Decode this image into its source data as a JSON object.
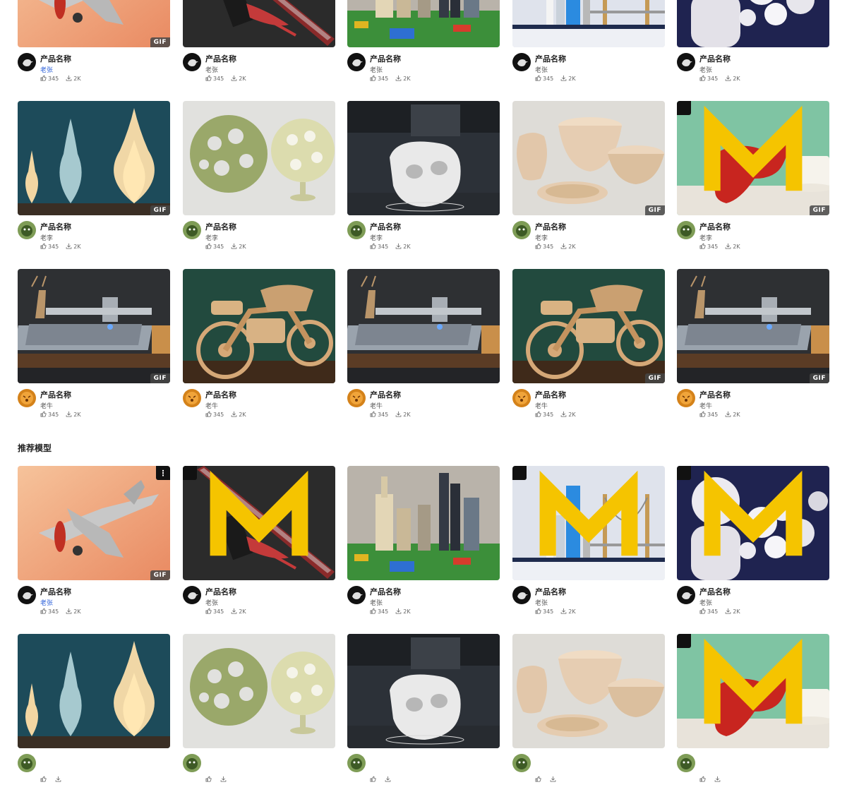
{
  "section": {
    "title": "推荐模型"
  },
  "icons": {
    "like": "thumbs-up-icon",
    "download": "download-icon",
    "brand": "brand-logo-icon",
    "more": "more-vertical-icon"
  },
  "thumbnails": {
    "airplane": {
      "name": "airplane-model",
      "bg": "#f0b68c",
      "accent": "#c8c8c8"
    },
    "sword": {
      "name": "sword-model",
      "bg": "#2b2b2b",
      "accent": "#c43a3a"
    },
    "city": {
      "name": "city-lego-model",
      "bg": "#b9b3aa",
      "accent": "#3c8f3a"
    },
    "skyline": {
      "name": "skyline-lego-model",
      "bg": "#dfe3ec",
      "accent": "#2b8be0"
    },
    "balloon": {
      "name": "balloon-figure-model",
      "bg": "#1f2350",
      "accent": "#eceaf0"
    },
    "lamps": {
      "name": "vase-lamp-model",
      "bg": "#1d4b5a",
      "accent": "#f2d6a2"
    },
    "spheres": {
      "name": "lattice-sphere-model",
      "bg": "#e1e1de",
      "accent": "#9aa86a"
    },
    "skull": {
      "name": "skull-lattice-model",
      "bg": "#2c3138",
      "accent": "#e9e9e9"
    },
    "bowls": {
      "name": "spiral-bowl-model",
      "bg": "#dedcd7",
      "accent": "#e6cdb2"
    },
    "rhino": {
      "name": "lattice-animal-model",
      "bg": "#7fc4a3",
      "accent": "#c8251f"
    },
    "laser": {
      "name": "laser-engraver-model",
      "bg": "#2e3033",
      "accent": "#9aa3ad"
    },
    "motorcycle": {
      "name": "wooden-motorcycle-model",
      "bg": "#224a3e",
      "accent": "#d5a877"
    }
  },
  "avatars": {
    "bird": {
      "bg": "#111111",
      "fg": "#e0e0e0"
    },
    "dino": {
      "bg": "#7e9c56",
      "fg": "#3d5a25"
    },
    "tiger": {
      "bg": "#d4821a",
      "fg": "#6b3306"
    }
  },
  "cards": [
    {
      "thumb": "airplane",
      "avatar": "bird",
      "title": "产品名称",
      "author": "老张",
      "author_active": true,
      "likes": "345",
      "downloads": "2K",
      "gif": "GIF",
      "brand": false,
      "more": false
    },
    {
      "thumb": "sword",
      "avatar": "bird",
      "title": "产品名称",
      "author": "老张",
      "author_active": false,
      "likes": "345",
      "downloads": "2K",
      "gif": "",
      "brand": false,
      "more": false
    },
    {
      "thumb": "city",
      "avatar": "bird",
      "title": "产品名称",
      "author": "老张",
      "author_active": false,
      "likes": "345",
      "downloads": "2K",
      "gif": "",
      "brand": false,
      "more": false
    },
    {
      "thumb": "skyline",
      "avatar": "bird",
      "title": "产品名称",
      "author": "老张",
      "author_active": false,
      "likes": "345",
      "downloads": "2K",
      "gif": "",
      "brand": false,
      "more": false
    },
    {
      "thumb": "balloon",
      "avatar": "bird",
      "title": "产品名称",
      "author": "老张",
      "author_active": false,
      "likes": "345",
      "downloads": "2K",
      "gif": "",
      "brand": false,
      "more": false
    },
    {
      "thumb": "lamps",
      "avatar": "dino",
      "title": "产品名称",
      "author": "老李",
      "author_active": false,
      "likes": "345",
      "downloads": "2K",
      "gif": "GIF",
      "brand": false,
      "more": false
    },
    {
      "thumb": "spheres",
      "avatar": "dino",
      "title": "产品名称",
      "author": "老李",
      "author_active": false,
      "likes": "345",
      "downloads": "2K",
      "gif": "",
      "brand": false,
      "more": false
    },
    {
      "thumb": "skull",
      "avatar": "dino",
      "title": "产品名称",
      "author": "老李",
      "author_active": false,
      "likes": "345",
      "downloads": "2K",
      "gif": "",
      "brand": false,
      "more": false
    },
    {
      "thumb": "bowls",
      "avatar": "dino",
      "title": "产品名称",
      "author": "老李",
      "author_active": false,
      "likes": "345",
      "downloads": "2K",
      "gif": "GIF",
      "brand": false,
      "more": false
    },
    {
      "thumb": "rhino",
      "avatar": "dino",
      "title": "产品名称",
      "author": "老李",
      "author_active": false,
      "likes": "345",
      "downloads": "2K",
      "gif": "GIF",
      "brand": true,
      "more": false
    },
    {
      "thumb": "laser",
      "avatar": "tiger",
      "title": "产品名称",
      "author": "老牛",
      "author_active": false,
      "likes": "345",
      "downloads": "2K",
      "gif": "GIF",
      "brand": false,
      "more": false
    },
    {
      "thumb": "motorcycle",
      "avatar": "tiger",
      "title": "产品名称",
      "author": "老牛",
      "author_active": false,
      "likes": "345",
      "downloads": "2K",
      "gif": "",
      "brand": false,
      "more": false
    },
    {
      "thumb": "laser",
      "avatar": "tiger",
      "title": "产品名称",
      "author": "老牛",
      "author_active": false,
      "likes": "345",
      "downloads": "2K",
      "gif": "",
      "brand": false,
      "more": false
    },
    {
      "thumb": "motorcycle",
      "avatar": "tiger",
      "title": "产品名称",
      "author": "老牛",
      "author_active": false,
      "likes": "345",
      "downloads": "2K",
      "gif": "GIF",
      "brand": false,
      "more": false
    },
    {
      "thumb": "laser",
      "avatar": "tiger",
      "title": "产品名称",
      "author": "老牛",
      "author_active": false,
      "likes": "345",
      "downloads": "2K",
      "gif": "GIF",
      "brand": false,
      "more": false
    },
    {
      "thumb": "airplane",
      "avatar": "bird",
      "title": "产品名称",
      "author": "老张",
      "author_active": true,
      "likes": "345",
      "downloads": "2K",
      "gif": "GIF",
      "brand": false,
      "more": true
    },
    {
      "thumb": "sword",
      "avatar": "bird",
      "title": "产品名称",
      "author": "老张",
      "author_active": false,
      "likes": "345",
      "downloads": "2K",
      "gif": "",
      "brand": true,
      "more": false
    },
    {
      "thumb": "city",
      "avatar": "bird",
      "title": "产品名称",
      "author": "老张",
      "author_active": false,
      "likes": "345",
      "downloads": "2K",
      "gif": "",
      "brand": false,
      "more": false
    },
    {
      "thumb": "skyline",
      "avatar": "bird",
      "title": "产品名称",
      "author": "老张",
      "author_active": false,
      "likes": "345",
      "downloads": "2K",
      "gif": "",
      "brand": true,
      "more": false
    },
    {
      "thumb": "balloon",
      "avatar": "bird",
      "title": "产品名称",
      "author": "老张",
      "author_active": false,
      "likes": "345",
      "downloads": "2K",
      "gif": "",
      "brand": true,
      "more": false
    },
    {
      "thumb": "lamps",
      "avatar": "dino",
      "title": "",
      "author": "",
      "author_active": false,
      "likes": "",
      "downloads": "",
      "gif": "",
      "brand": false,
      "more": false
    },
    {
      "thumb": "spheres",
      "avatar": "dino",
      "title": "",
      "author": "",
      "author_active": false,
      "likes": "",
      "downloads": "",
      "gif": "",
      "brand": false,
      "more": false
    },
    {
      "thumb": "skull",
      "avatar": "dino",
      "title": "",
      "author": "",
      "author_active": false,
      "likes": "",
      "downloads": "",
      "gif": "",
      "brand": false,
      "more": false
    },
    {
      "thumb": "bowls",
      "avatar": "dino",
      "title": "",
      "author": "",
      "author_active": false,
      "likes": "",
      "downloads": "",
      "gif": "",
      "brand": false,
      "more": false
    },
    {
      "thumb": "rhino",
      "avatar": "dino",
      "title": "",
      "author": "",
      "author_active": false,
      "likes": "",
      "downloads": "",
      "gif": "",
      "brand": true,
      "more": false
    }
  ]
}
